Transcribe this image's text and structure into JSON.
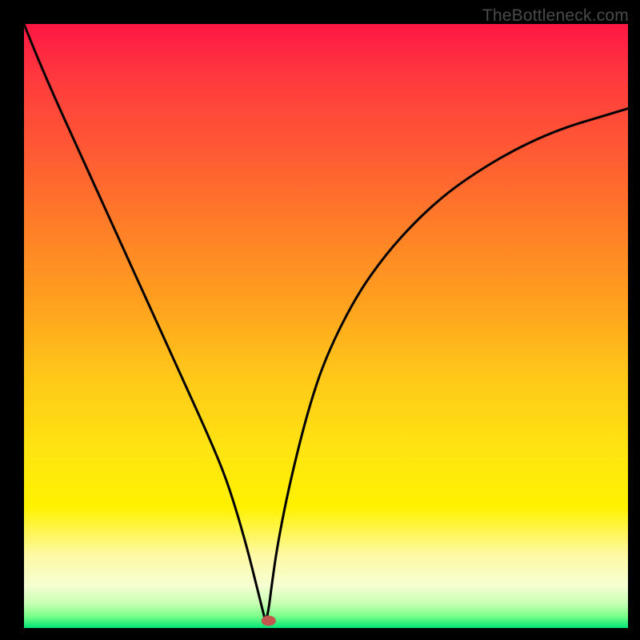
{
  "watermark": {
    "text": "TheBottleneck.com"
  },
  "chart_data": {
    "type": "line",
    "title": "",
    "xlabel": "",
    "ylabel": "",
    "xlim": [
      0,
      100
    ],
    "ylim": [
      0,
      100
    ],
    "grid": false,
    "x": [
      0,
      2,
      5,
      10,
      15,
      20,
      25,
      30,
      33,
      35,
      37,
      38.5,
      39.5,
      40,
      40.5,
      41,
      42,
      44,
      47,
      50,
      55,
      60,
      65,
      70,
      75,
      80,
      85,
      90,
      95,
      100
    ],
    "values": [
      100,
      95,
      88,
      77,
      66,
      55,
      44,
      33,
      26,
      20,
      13,
      7,
      3,
      1,
      3,
      7,
      14,
      24,
      36,
      45,
      55,
      62,
      67.5,
      72,
      75.5,
      78.5,
      81,
      83,
      84.5,
      86
    ],
    "marker": {
      "x": 40.5,
      "y": 1.2
    },
    "line_color": "#000000",
    "marker_color": "#c2574f",
    "notes": "V-shaped bottleneck curve; minimum (optimal match) near x≈40 where value≈1. Values are percentage-like (0–100) estimated from pixel position on an unlabeled gradient axis."
  }
}
